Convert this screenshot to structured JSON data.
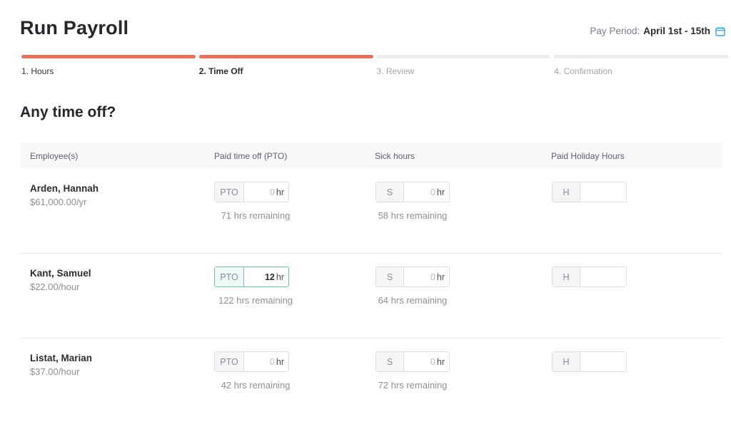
{
  "header": {
    "title": "Run Payroll",
    "pay_period_label": "Pay Period:",
    "pay_period_value": "April 1st - 15th",
    "calendar_icon": "calendar-icon"
  },
  "colors": {
    "accent": "#e4735d",
    "active_field": "#72c0b7",
    "calendar": "#3aa0d8"
  },
  "steps": [
    {
      "label": "1. Hours",
      "state": "done"
    },
    {
      "label": "2. Time Off",
      "state": "current"
    },
    {
      "label": "3. Review",
      "state": "pending"
    },
    {
      "label": "4. Confirmation",
      "state": "pending"
    }
  ],
  "section": {
    "title": "Any time off?"
  },
  "table": {
    "headers": {
      "employee": "Employee(s)",
      "pto": "Paid time off (PTO)",
      "sick": "Sick hours",
      "holiday": "Paid Holiday Hours"
    },
    "prefixes": {
      "pto": "PTO",
      "sick": "S",
      "holiday": "H"
    },
    "unit": "hr",
    "rows": [
      {
        "name": "Arden, Hannah",
        "rate": "$61,000.00/yr",
        "pto_value": "0",
        "pto_remaining": "71 hrs remaining",
        "sick_value": "0",
        "sick_remaining": "58 hrs remaining",
        "holiday_value": ""
      },
      {
        "name": "Kant, Samuel",
        "rate": "$22.00/hour",
        "pto_value": "12",
        "pto_remaining": "122 hrs remaining",
        "sick_value": "0",
        "sick_remaining": "64 hrs remaining",
        "holiday_value": ""
      },
      {
        "name": "Listat, Marian",
        "rate": "$37.00/hour",
        "pto_value": "0",
        "pto_remaining": "42 hrs remaining",
        "sick_value": "0",
        "sick_remaining": "72 hrs remaining",
        "holiday_value": ""
      }
    ]
  }
}
